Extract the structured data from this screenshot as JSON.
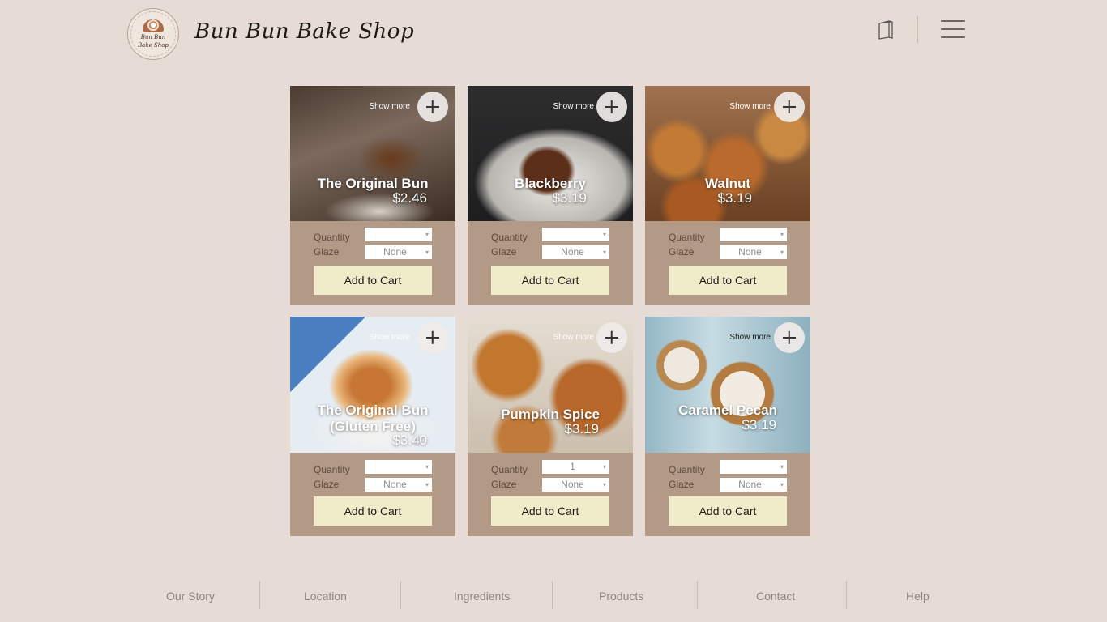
{
  "header": {
    "brand": "Bun Bun Bake Shop",
    "logo_text_top": "Bun Bun",
    "logo_text_bottom": "Bake Shop",
    "icons": [
      "book-icon",
      "menu-icon"
    ]
  },
  "products": [
    {
      "name": "The Original Bun",
      "price": "$2.46",
      "quantity": "",
      "glaze": "None",
      "show_more": "Show more",
      "add_label": "Add to Cart"
    },
    {
      "name": "Blackberry",
      "price": "$3.19",
      "quantity": "",
      "glaze": "None",
      "show_more": "Show more",
      "add_label": "Add to Cart"
    },
    {
      "name": "Walnut",
      "price": "$3.19",
      "quantity": "",
      "glaze": "None",
      "show_more": "Show more",
      "add_label": "Add to Cart"
    },
    {
      "name": "The Original Bun (Gluten Free)",
      "price": "$3.40",
      "quantity": "",
      "glaze": "None",
      "show_more": "Show more",
      "add_label": "Add to Cart"
    },
    {
      "name": "Pumpkin Spice",
      "price": "$3.19",
      "quantity": "1",
      "glaze": "None",
      "show_more": "Show more",
      "add_label": "Add to Cart"
    },
    {
      "name": "Caramel Pecan",
      "price": "$3.19",
      "quantity": "",
      "glaze": "None",
      "show_more": "Show more",
      "add_label": "Add to Cart"
    }
  ],
  "labels": {
    "quantity": "Quantity",
    "glaze": "Glaze"
  },
  "footer": {
    "links": [
      "Our Story",
      "Location",
      "Ingredients",
      "Products",
      "Contact",
      "Help"
    ]
  },
  "colors": {
    "background": "#e6dcd5",
    "card": "#b39a86",
    "button": "#f0ecca"
  }
}
